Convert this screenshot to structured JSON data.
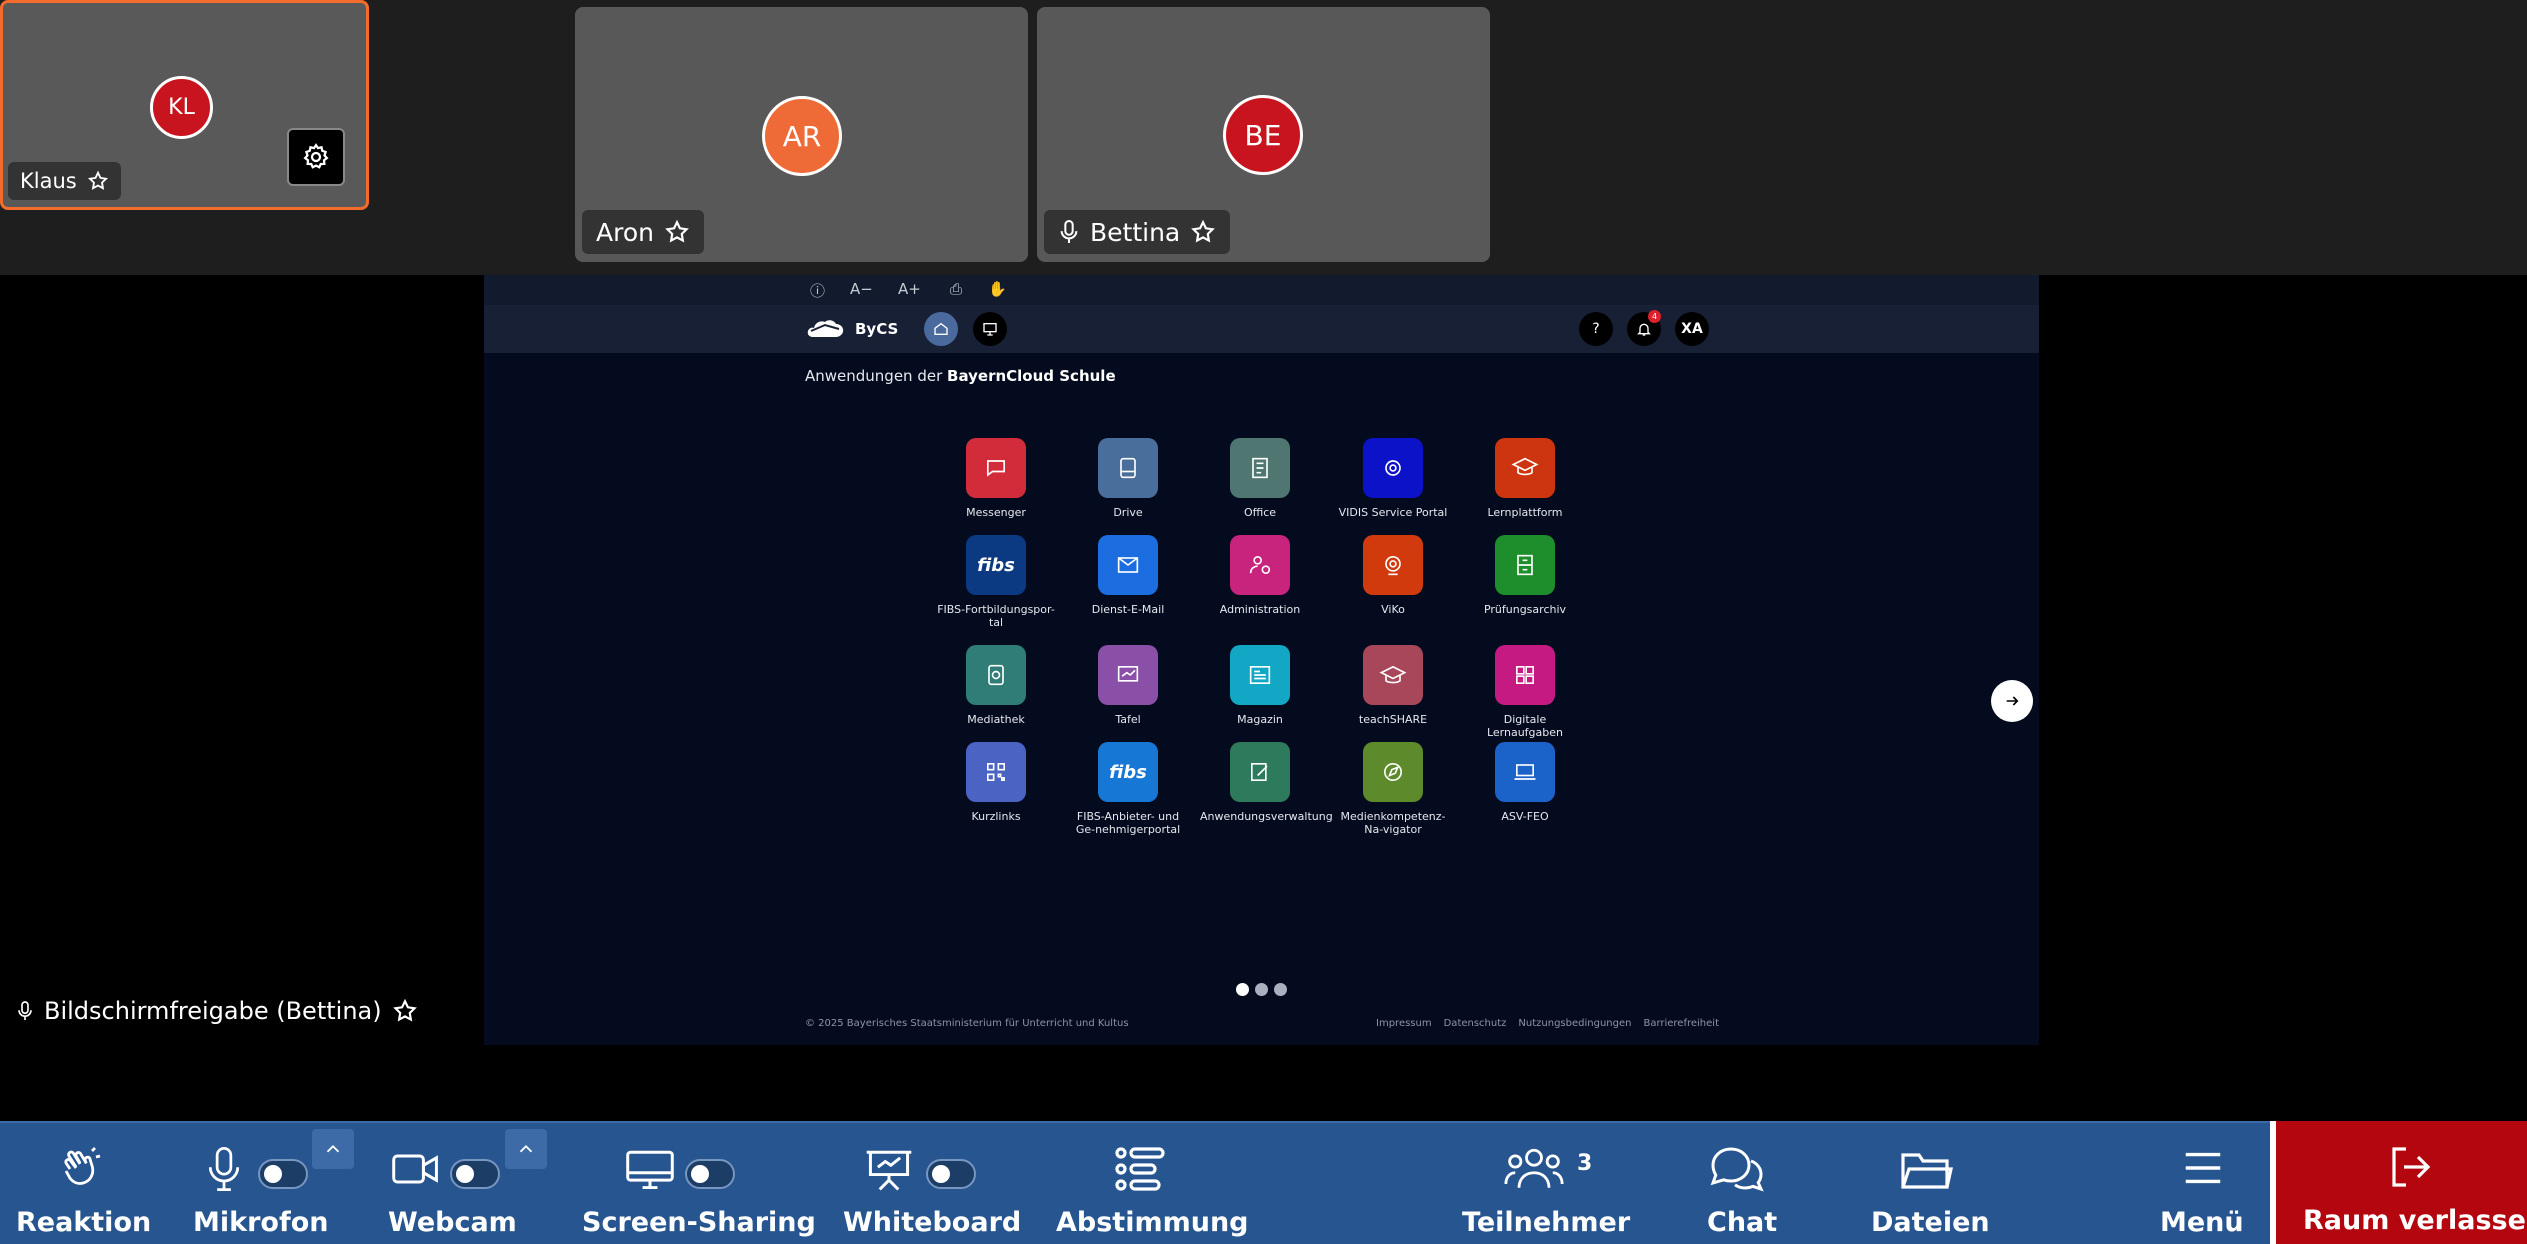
{
  "participants": {
    "klaus": {
      "initials": "KL",
      "name": "Klaus"
    },
    "aron": {
      "initials": "AR",
      "name": "Aron"
    },
    "bettina": {
      "initials": "BE",
      "name": "Bettina"
    }
  },
  "screen": {
    "accessibility": {
      "font_smaller": "A−",
      "font_larger": "A+"
    },
    "brand": "ByCS",
    "user_initials": "XA",
    "help": "?",
    "notification_count": "4",
    "section_prefix": "Anwendungen der ",
    "section_brand": "BayernCloud Schule",
    "apps": [
      {
        "label": "Messenger",
        "color": "#d22c3b",
        "icon": "chat-icon"
      },
      {
        "label": "Drive",
        "color": "#4a6e9b",
        "icon": "drive-icon"
      },
      {
        "label": "Office",
        "color": "#4f7670",
        "icon": "office-icon"
      },
      {
        "label": "VIDIS Service Portal",
        "color": "#0c12c8",
        "icon": "vidis-icon"
      },
      {
        "label": "Lernplattform",
        "color": "#cc3510",
        "icon": "graduation-cap-icon"
      },
      {
        "label": "FIBS-Fortbildungspor-tal",
        "color": "#0c3a82",
        "icon": "fibs-icon"
      },
      {
        "label": "Dienst-E-Mail",
        "color": "#1c6ee0",
        "icon": "mail-icon"
      },
      {
        "label": "Administration",
        "color": "#c8247d",
        "icon": "admin-icon"
      },
      {
        "label": "ViKo",
        "color": "#d03a0d",
        "icon": "webcam-icon"
      },
      {
        "label": "Prüfungsarchiv",
        "color": "#1e8e2c",
        "icon": "archive-icon"
      },
      {
        "label": "Mediathek",
        "color": "#2f7d76",
        "icon": "media-icon"
      },
      {
        "label": "Tafel",
        "color": "#8a4fa6",
        "icon": "board-icon"
      },
      {
        "label": "Magazin",
        "color": "#12a7c5",
        "icon": "magazine-icon"
      },
      {
        "label": "teachSHARE",
        "color": "#a8475a",
        "icon": "share-cap-icon"
      },
      {
        "label": "Digitale Lernaufgaben",
        "color": "#c41a81",
        "icon": "tasks-icon"
      },
      {
        "label": "Kurzlinks",
        "color": "#4b63c2",
        "icon": "qr-icon"
      },
      {
        "label": "FIBS-Anbieter- und Ge-nehmigerportal",
        "color": "#1677d4",
        "icon": "fibs-icon"
      },
      {
        "label": "Anwendungsverwaltung",
        "color": "#2e7a5c",
        "icon": "edit-icon"
      },
      {
        "label": "Medienkompetenz-Na-vigator",
        "color": "#5d8a2a",
        "icon": "compass-icon"
      },
      {
        "label": "ASV-FEO",
        "color": "#1b63c9",
        "icon": "laptop-icon"
      }
    ],
    "fibs_text": "fibs",
    "footer_copyright": "© 2025 Bayerisches Staatsministerium für Unterricht und Kultus",
    "footer_links": [
      "Impressum",
      "Datenschutz",
      "Nutzungsbedingungen",
      "Barrierefreiheit"
    ]
  },
  "share_label": "Bildschirmfreigabe (Bettina)",
  "toolbar": {
    "reaction": "Reaktion",
    "microphone": "Mikrofon",
    "webcam": "Webcam",
    "screen_sharing": "Screen-Sharing",
    "whiteboard": "Whiteboard",
    "poll": "Abstimmung",
    "participants": "Teilnehmer",
    "participants_count": "3",
    "chat": "Chat",
    "files": "Dateien",
    "menu": "Menü",
    "leave": "Raum verlassen"
  }
}
